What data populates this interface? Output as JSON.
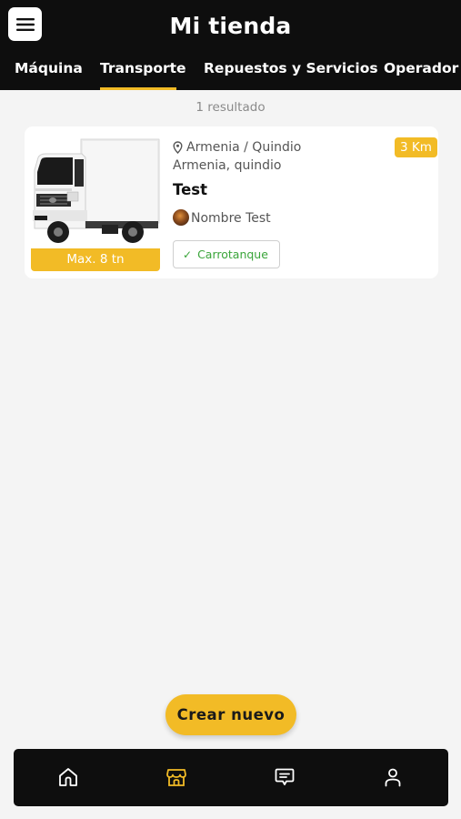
{
  "header": {
    "title": "Mi tienda",
    "menu_icon": "hamburger-menu-icon"
  },
  "tabs": [
    {
      "label": "Máquina"
    },
    {
      "label": "Transporte",
      "active": true
    },
    {
      "label": "Repuestos y Servicios"
    },
    {
      "label": "Operador"
    }
  ],
  "results": {
    "count_text": "1 resultado"
  },
  "listing": {
    "capacity_label": "Max. 8 tn",
    "location_line1": "Armenia / Quindio",
    "location_line2": "Armenia, quindio",
    "distance": "3 Km",
    "title": "Test",
    "owner_name": "Nombre Test",
    "category": "Carrotanque",
    "thumbnail": "white-box-truck-image"
  },
  "actions": {
    "create_label": "Crear nuevo"
  },
  "bottom_nav": [
    {
      "name": "home",
      "icon": "home-icon"
    },
    {
      "name": "store",
      "icon": "store-icon",
      "active": true
    },
    {
      "name": "messages",
      "icon": "chat-icon"
    },
    {
      "name": "profile",
      "icon": "user-icon"
    }
  ],
  "colors": {
    "accent": "#f2bb26",
    "header_bg": "#0e0e0e",
    "page_bg": "#f4f4f4",
    "chip_text": "#3aa53a"
  }
}
